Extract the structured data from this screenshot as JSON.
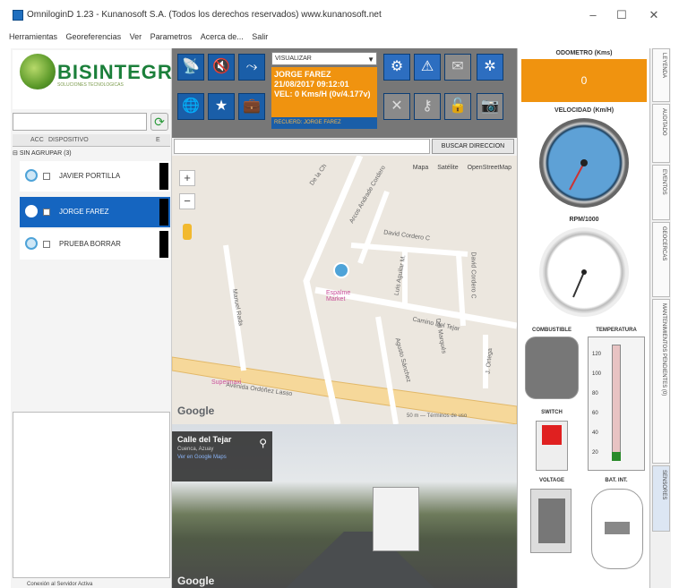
{
  "window": {
    "title": "OmniloginD 1.23 - Kunanosoft S.A. (Todos los derechos reservados) www.kunanosoft.net",
    "minimize": "–",
    "maximize": "☐",
    "close": "✕"
  },
  "menu": [
    "Herramientas",
    "Georeferencias",
    "Ver",
    "Parametros",
    "Acerca de...",
    "Salir"
  ],
  "logo": {
    "text": "BISINTEGRA",
    "subtitle": "SOLUCIONES TECNOLOGICAS"
  },
  "device_list": {
    "headers": {
      "acc": "ACC",
      "device": "DISPOSITIVO",
      "e": "E"
    },
    "group": "SIN AGRUPAR (3)",
    "devices": [
      {
        "name": "JAVIER PORTILLA",
        "selected": false
      },
      {
        "name": "JORGE FAREZ",
        "selected": true
      },
      {
        "name": "PRUEBA BORRAR",
        "selected": false
      }
    ],
    "footer": "Conexión al Servidor Activa"
  },
  "vehicle_panel": {
    "select_value": "VISUALIZAR",
    "driver": "JORGE FAREZ",
    "datetime": "21/08/2017 09:12:01",
    "speed": "VEL: 0 Kms/H (0v/4.177v)",
    "footer": "RECUERD: JORGE FAREZ"
  },
  "address": {
    "button": "BUSCAR DIRECCION"
  },
  "map": {
    "layers": [
      "Mapa",
      "Satélite",
      "OpenStreetMap"
    ],
    "zoom_in": "+",
    "zoom_out": "−",
    "streets": [
      "De la Ch",
      "Sierra",
      "Arcos Andrade Cordero",
      "David Cordero C",
      "Luis Aguilar M.",
      "David Cordero C",
      "Camino Del Tejar",
      "Del Marqués",
      "Agusto Sánchez",
      "Manuel Rada",
      "J. Ortega",
      "Avenida Ordóñez Lasso"
    ],
    "places": [
      "Espalme Market",
      "Supermaxi"
    ],
    "footer": "50 m — Términos de uso",
    "google": "Google"
  },
  "streetview": {
    "title": "Calle del Tejar",
    "location": "Cuenca, Azuay",
    "link": "Ver en Google Maps",
    "google": "Google"
  },
  "gauges": {
    "odometer_label": "ODOMETRO (Kms)",
    "odometer_value": "0",
    "speed_label": "VELOCIDAD (Km/H)",
    "rpm_label": "RPM/1000",
    "fuel_label": "COMBUSTIBLE",
    "temp_label": "TEMPERATURA",
    "temp_ticks": [
      "120",
      "100",
      "80",
      "60",
      "40",
      "20"
    ],
    "switch_label": "SWITCH",
    "voltage_label": "VOLTAGE",
    "bat_label": "BAT. INT."
  },
  "side_tabs": [
    "LEYENDA",
    "AUDITADO",
    "EVENTOS",
    "GEOCERCAS",
    "MANTENIMIENTOS PENDIENTES (0)",
    "SENSORES"
  ],
  "colors": {
    "accent_orange": "#f0930f",
    "accent_blue": "#1a5ea8",
    "selected_row": "#1565c0"
  }
}
